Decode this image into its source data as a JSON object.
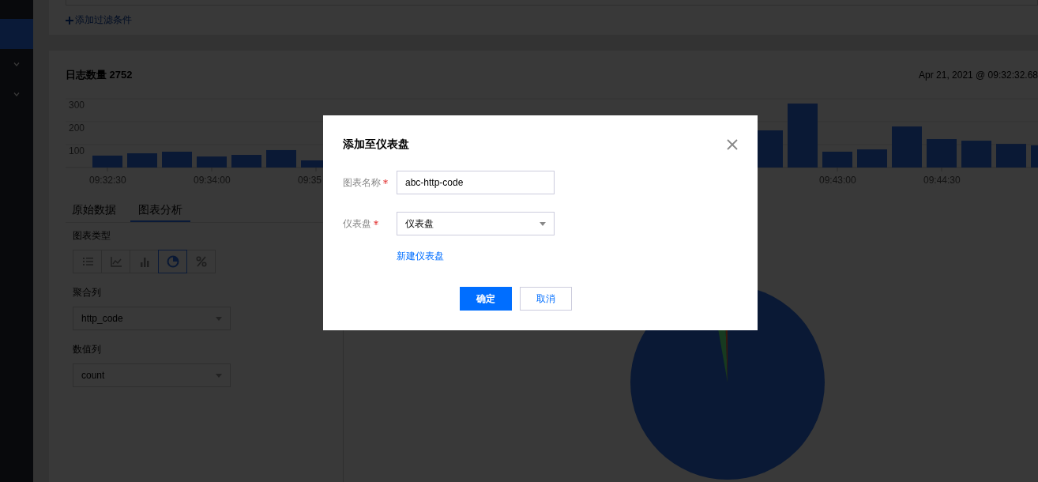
{
  "sidebar": {
    "items": [
      {
        "kind": "item",
        "selected": true
      },
      {
        "kind": "group",
        "selected": false,
        "expanded": false
      },
      {
        "kind": "group",
        "selected": false,
        "expanded": false
      }
    ]
  },
  "filter": {
    "add_link": "添加过滤条件"
  },
  "log_panel": {
    "title": "日志数量 2752",
    "time_range": "Apr 21, 2021 @ 09:32:32.68",
    "chart_data": {
      "type": "bar",
      "categories": [
        "09:32:30",
        null,
        null,
        "09:34:00",
        null,
        null,
        "09:35",
        null,
        null,
        null,
        null,
        null,
        null,
        null,
        null,
        null,
        null,
        null,
        null,
        null,
        null,
        "09:43:00",
        null,
        null,
        "09:44:30",
        null,
        null,
        null
      ],
      "values": [
        52,
        62,
        69,
        48,
        55,
        76,
        31,
        null,
        null,
        null,
        null,
        null,
        null,
        null,
        null,
        null,
        null,
        null,
        null,
        162,
        279,
        69,
        79,
        179,
        124,
        117,
        103,
        97
      ],
      "ylim": [
        0,
        300
      ],
      "yticks": [
        100,
        200,
        300
      ]
    }
  },
  "tabs": [
    {
      "label": "原始数据",
      "selected": false
    },
    {
      "label": "图表分析",
      "selected": true
    }
  ],
  "chart_options": {
    "type_label": "图表类型",
    "chart_types": [
      {
        "kind": "table",
        "selected": false
      },
      {
        "kind": "line",
        "selected": false
      },
      {
        "kind": "bar",
        "selected": false
      },
      {
        "kind": "pie",
        "selected": true
      },
      {
        "kind": "percent",
        "selected": false
      }
    ],
    "group_label": "聚合列",
    "group_value": "http_code",
    "value_label": "数值列",
    "value_value": "count"
  },
  "dialog": {
    "title": "添加至仪表盘",
    "fields": [
      {
        "kind": "input",
        "label": "图表名称",
        "required": true,
        "value": "abc-http-code"
      },
      {
        "kind": "select",
        "label": "仪表盘",
        "required": true,
        "value": "仪表盘"
      }
    ],
    "link": "新建仪表盘",
    "buttons": [
      {
        "label": "确定",
        "kind": "primary"
      },
      {
        "label": "取消",
        "kind": "default"
      }
    ]
  }
}
